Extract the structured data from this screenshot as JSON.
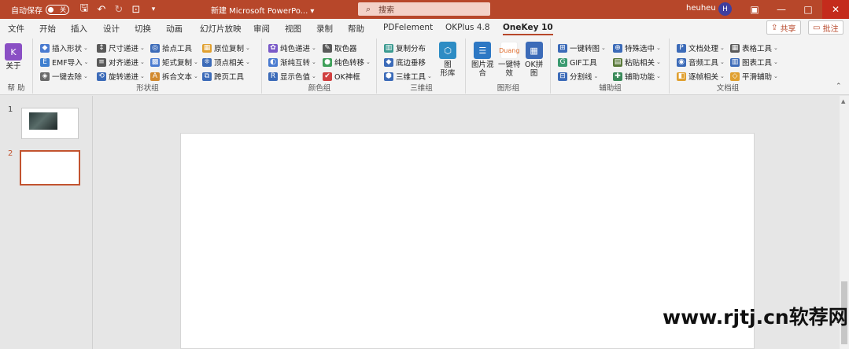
{
  "titlebar": {
    "autosave_label": "自动保存",
    "autosave_state": "关",
    "doc_title": "新建 Microsoft PowerPo... ▾",
    "search_placeholder": "搜索",
    "user_name": "heuheu",
    "user_initial": "H",
    "colors": {
      "bar": "#b7472a",
      "search": "#f3d1c7"
    }
  },
  "tabs": [
    "文件",
    "开始",
    "插入",
    "设计",
    "切换",
    "动画",
    "幻灯片放映",
    "审阅",
    "视图",
    "录制",
    "帮助",
    "PDFelement",
    "OKPlus 4.8",
    "OneKey 10"
  ],
  "active_tab": "OneKey 10",
  "share_label": "共享",
  "comment_label": "批注",
  "ribbon": {
    "help_group": {
      "about": "关于",
      "label": "帮 助"
    },
    "shape_group": {
      "label": "形状组",
      "items": [
        "插入形状",
        "尺寸递进",
        "拾点工具",
        "原位复制",
        "EMF导入",
        "对齐递进",
        "矩式复制",
        "顶点相关",
        "一键去除",
        "旋转递进",
        "拆合文本",
        "跨页工具"
      ]
    },
    "color_group": {
      "label": "颜色组",
      "items": [
        "纯色递进",
        "取色器",
        "渐纯互转",
        "纯色转移",
        "显示色值",
        "OK神框"
      ]
    },
    "3d_group": {
      "label": "三维组",
      "items": [
        "复制分布",
        "底边垂移",
        "三维工具"
      ],
      "big": "图\n形库"
    },
    "graphic_group": {
      "label": "图形组",
      "big1": "图片混\n合",
      "big2": "一键特\n效",
      "big3": "OK拼\n图",
      "duang": "Duang"
    },
    "aux_group": {
      "label": "辅助组",
      "items": [
        "一键转图",
        "特殊选中",
        "GIF工具",
        "粘贴相关",
        "分割线",
        "辅助功能"
      ]
    },
    "doc_group": {
      "label": "文档组",
      "items": [
        "文档处理",
        "表格工具",
        "音频工具",
        "图表工具",
        "逐帧相关",
        "平滑辅助"
      ]
    }
  },
  "slides": [
    {
      "number": "1"
    },
    {
      "number": "2"
    }
  ],
  "watermark": "www.rjtj.cn软荐网"
}
